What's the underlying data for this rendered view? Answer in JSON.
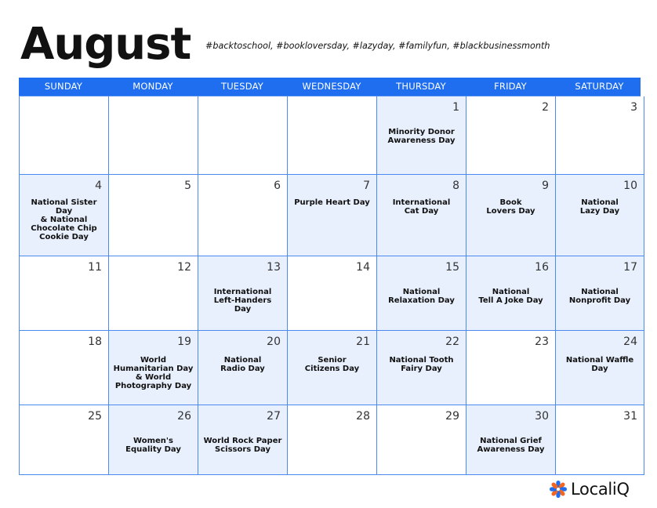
{
  "month": "August",
  "hashtags": "#backtoschool, #bookloversday, #lazyday, #familyfun, #blackbusinessmonth",
  "weekdays": [
    "SUNDAY",
    "MONDAY",
    "TUESDAY",
    "WEDNESDAY",
    "THURSDAY",
    "FRIDAY",
    "SATURDAY"
  ],
  "colors": {
    "header": "#1f6ef0",
    "grid_line": "#4c8af2",
    "shaded_cell": "#e8effd",
    "logo_blue": "#1f6ef0",
    "logo_orange": "#f26522"
  },
  "weeks": [
    [
      {
        "day": "",
        "event": ""
      },
      {
        "day": "",
        "event": ""
      },
      {
        "day": "",
        "event": ""
      },
      {
        "day": "",
        "event": ""
      },
      {
        "day": "1",
        "event": "Minority Donor\nAwareness Day"
      },
      {
        "day": "2",
        "event": ""
      },
      {
        "day": "3",
        "event": ""
      }
    ],
    [
      {
        "day": "4",
        "event": "National Sister Day\n& National\nChocolate Chip\nCookie Day"
      },
      {
        "day": "5",
        "event": ""
      },
      {
        "day": "6",
        "event": ""
      },
      {
        "day": "7",
        "event": "Purple Heart Day"
      },
      {
        "day": "8",
        "event": "International\nCat Day"
      },
      {
        "day": "9",
        "event": "Book\nLovers Day"
      },
      {
        "day": "10",
        "event": "National\nLazy Day"
      }
    ],
    [
      {
        "day": "11",
        "event": ""
      },
      {
        "day": "12",
        "event": ""
      },
      {
        "day": "13",
        "event": "International\nLeft-Handers\nDay"
      },
      {
        "day": "14",
        "event": ""
      },
      {
        "day": "15",
        "event": "National\nRelaxation Day"
      },
      {
        "day": "16",
        "event": "National\nTell A Joke Day"
      },
      {
        "day": "17",
        "event": "National\nNonprofit Day"
      }
    ],
    [
      {
        "day": "18",
        "event": ""
      },
      {
        "day": "19",
        "event": "World\nHumanitarian Day\n& World\nPhotography Day"
      },
      {
        "day": "20",
        "event": "National\nRadio Day"
      },
      {
        "day": "21",
        "event": "Senior\nCitizens Day"
      },
      {
        "day": "22",
        "event": "National Tooth\nFairy Day"
      },
      {
        "day": "23",
        "event": ""
      },
      {
        "day": "24",
        "event": "National Waffle\nDay"
      }
    ],
    [
      {
        "day": "25",
        "event": ""
      },
      {
        "day": "26",
        "event": "Women's\nEquality Day"
      },
      {
        "day": "27",
        "event": "World Rock Paper\nScissors Day"
      },
      {
        "day": "28",
        "event": ""
      },
      {
        "day": "29",
        "event": ""
      },
      {
        "day": "30",
        "event": "National Grief\nAwareness Day"
      },
      {
        "day": "31",
        "event": ""
      }
    ]
  ],
  "logo": {
    "icon": "localiq-flower-icon",
    "text": "LocaliQ"
  }
}
